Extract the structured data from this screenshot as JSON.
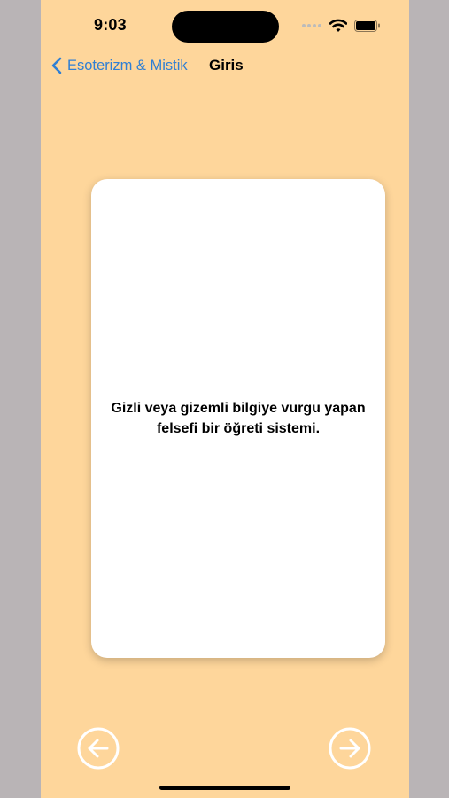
{
  "status_bar": {
    "time": "9:03",
    "icons": [
      "cellular-icon",
      "wifi-icon",
      "battery-icon"
    ]
  },
  "nav": {
    "back_label": "Esoterizm & Mistik",
    "title": "Giris"
  },
  "card": {
    "text": "Gizli veya gizemli bilgiye vurgu yapan felsefi bir öğreti sistemi."
  },
  "controls": {
    "previous_icon": "arrow-left-circle-icon",
    "next_icon": "arrow-right-circle-icon"
  },
  "colors": {
    "background": "#fed69b",
    "accent": "#2f7fd4",
    "card": "#ffffff"
  }
}
